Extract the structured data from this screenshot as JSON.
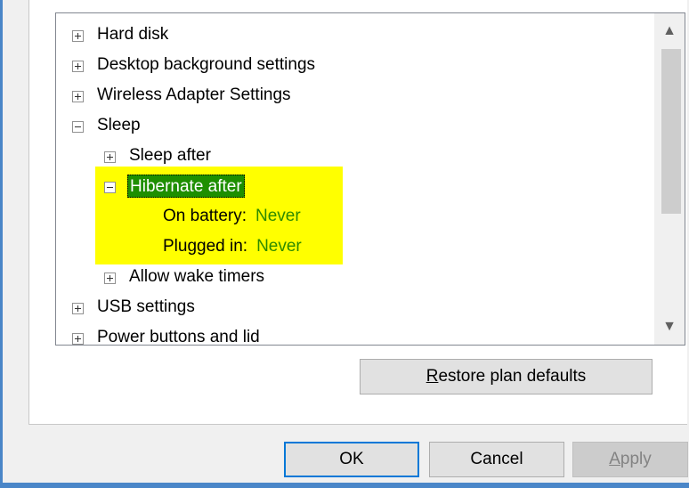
{
  "tree": {
    "items": [
      {
        "label": "Hard disk",
        "state": "collapsed"
      },
      {
        "label": "Desktop background settings",
        "state": "collapsed"
      },
      {
        "label": "Wireless Adapter Settings",
        "state": "collapsed"
      },
      {
        "label": "Sleep",
        "state": "expanded"
      },
      {
        "label": "Sleep after",
        "state": "collapsed"
      },
      {
        "label": "Hibernate after",
        "state": "expanded",
        "selected": true
      },
      {
        "label": "On battery:",
        "value": "Never"
      },
      {
        "label": "Plugged in:",
        "value": "Never"
      },
      {
        "label": "Allow wake timers",
        "state": "collapsed"
      },
      {
        "label": "USB settings",
        "state": "collapsed"
      },
      {
        "label": "Power buttons and lid",
        "state": "collapsed"
      }
    ]
  },
  "scrollbar": {
    "up_icon": "▲",
    "down_icon": "▼"
  },
  "buttons": {
    "restore": "Restore plan defaults",
    "ok": "OK",
    "cancel": "Cancel",
    "apply": "Apply"
  },
  "colors": {
    "highlight": "#ffff00",
    "selection": "#1e8f00",
    "value_text": "#2e8b00",
    "focus_border": "#0078d7"
  }
}
